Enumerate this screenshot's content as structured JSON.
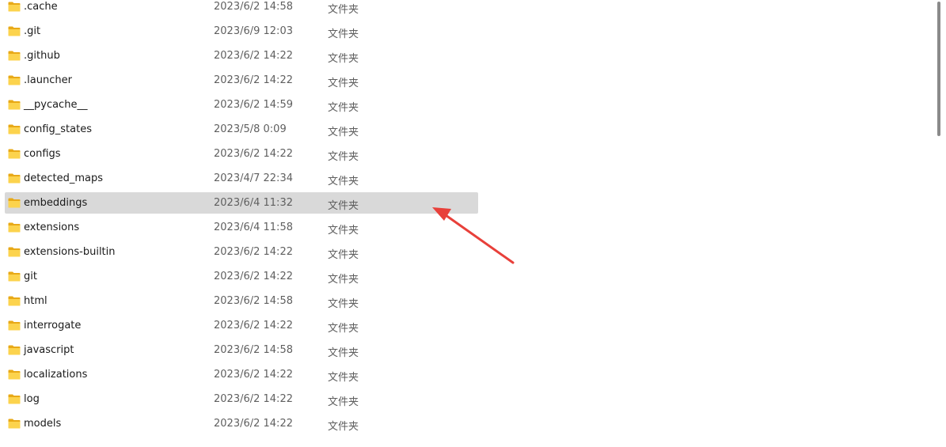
{
  "files": [
    {
      "name": ".cache",
      "date": "2023/6/2 14:58",
      "type": "文件夹"
    },
    {
      "name": ".git",
      "date": "2023/6/9 12:03",
      "type": "文件夹"
    },
    {
      "name": ".github",
      "date": "2023/6/2 14:22",
      "type": "文件夹"
    },
    {
      "name": ".launcher",
      "date": "2023/6/2 14:22",
      "type": "文件夹"
    },
    {
      "name": "__pycache__",
      "date": "2023/6/2 14:59",
      "type": "文件夹"
    },
    {
      "name": "config_states",
      "date": "2023/5/8 0:09",
      "type": "文件夹"
    },
    {
      "name": "configs",
      "date": "2023/6/2 14:22",
      "type": "文件夹"
    },
    {
      "name": "detected_maps",
      "date": "2023/4/7 22:34",
      "type": "文件夹"
    },
    {
      "name": "embeddings",
      "date": "2023/6/4 11:32",
      "type": "文件夹"
    },
    {
      "name": "extensions",
      "date": "2023/6/4 11:58",
      "type": "文件夹"
    },
    {
      "name": "extensions-builtin",
      "date": "2023/6/2 14:22",
      "type": "文件夹"
    },
    {
      "name": "git",
      "date": "2023/6/2 14:22",
      "type": "文件夹"
    },
    {
      "name": "html",
      "date": "2023/6/2 14:58",
      "type": "文件夹"
    },
    {
      "name": "interrogate",
      "date": "2023/6/2 14:22",
      "type": "文件夹"
    },
    {
      "name": "javascript",
      "date": "2023/6/2 14:58",
      "type": "文件夹"
    },
    {
      "name": "localizations",
      "date": "2023/6/2 14:22",
      "type": "文件夹"
    },
    {
      "name": "log",
      "date": "2023/6/2 14:22",
      "type": "文件夹"
    },
    {
      "name": "models",
      "date": "2023/6/2 14:22",
      "type": "文件夹"
    }
  ],
  "selected_index": 8,
  "icons": {
    "folder": "folder-icon",
    "annotation": "red-arrow-annotation"
  },
  "colors": {
    "folder_back": "#e8a917",
    "folder_front": "#fcd34d",
    "selection": "#d9d9d9",
    "annotation_arrow": "#e8403a"
  }
}
